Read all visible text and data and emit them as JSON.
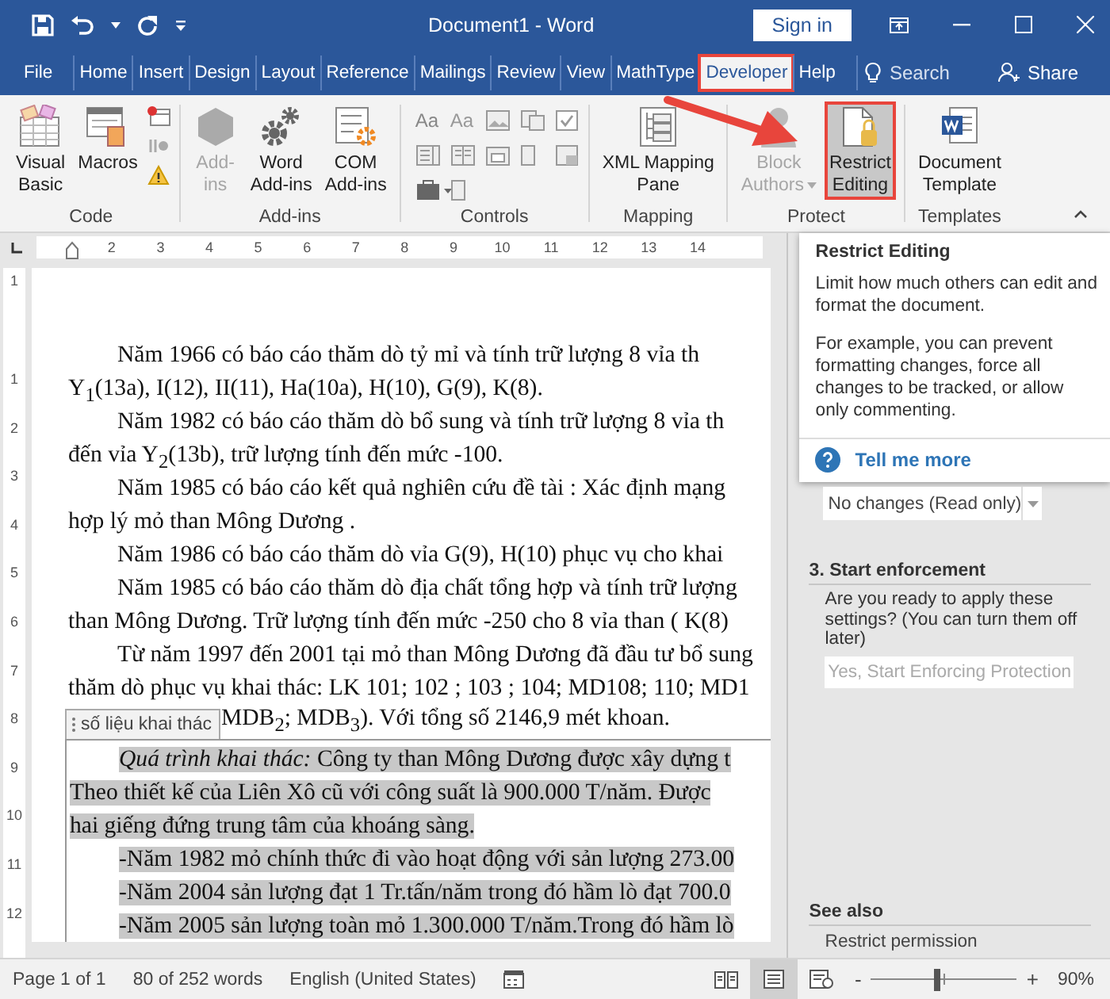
{
  "window": {
    "title": "Document1  -  Word",
    "sign_in": "Sign in"
  },
  "tabs": [
    {
      "label": "File",
      "selected": false,
      "highlighted": false
    },
    {
      "label": "Home",
      "selected": false,
      "highlighted": false
    },
    {
      "label": "Insert",
      "selected": false,
      "highlighted": false
    },
    {
      "label": "Design",
      "selected": false,
      "highlighted": false
    },
    {
      "label": "Layout",
      "selected": false,
      "highlighted": false
    },
    {
      "label": "Reference",
      "selected": false,
      "highlighted": false
    },
    {
      "label": "Mailings",
      "selected": false,
      "highlighted": false
    },
    {
      "label": "Review",
      "selected": false,
      "highlighted": false
    },
    {
      "label": "View",
      "selected": false,
      "highlighted": false
    },
    {
      "label": "MathType",
      "selected": false,
      "highlighted": false
    },
    {
      "label": "Developer",
      "selected": true,
      "highlighted": true
    },
    {
      "label": "Help",
      "selected": false,
      "highlighted": false
    }
  ],
  "search": {
    "placeholder": "Search"
  },
  "share": "Share",
  "ribbon": {
    "code": {
      "label": "Code",
      "visual_basic": "Visual\nBasic",
      "macros": "Macros"
    },
    "addins": {
      "label": "Add-ins",
      "buttons": [
        {
          "label": "Add-\nins",
          "disabled": true
        },
        {
          "label": "Word\nAdd-ins",
          "disabled": false
        },
        {
          "label": "COM\nAdd-ins",
          "disabled": false
        }
      ]
    },
    "controls": {
      "label": "Controls",
      "rich_text_glyph": "Aa",
      "plain_text_glyph": "Aa"
    },
    "mapping": {
      "label": "Mapping",
      "button": "XML Mapping\nPane"
    },
    "protect": {
      "label": "Protect",
      "buttons": [
        {
          "label": "Block\nAuthors",
          "disabled": true,
          "pressed": false,
          "highlighted": false
        },
        {
          "label": "Restrict\nEditing",
          "disabled": false,
          "pressed": true,
          "highlighted": true
        }
      ]
    },
    "templates": {
      "label": "Templates",
      "button": "Document\nTemplate"
    }
  },
  "ruler": {
    "horizontal": [
      "2",
      "3",
      "4",
      "5",
      "6",
      "7",
      "8",
      "9",
      "10",
      "11",
      "12",
      "13",
      "14"
    ],
    "vertical": [
      "1",
      "1",
      "2",
      "3",
      "4",
      "5",
      "6",
      "7",
      "8",
      "9",
      "10",
      "11",
      "12"
    ]
  },
  "document": {
    "lines": [
      {
        "text": "Năm 1966 có báo cáo thăm dò tỷ mỉ và tính trữ lượng 8 vỉa th",
        "indent": true
      },
      {
        "text": "Y$_{1}$(13a), I(12), II(11), Ha(10a), H(10), G(9), K(8).",
        "indent": false
      },
      {
        "text": "Năm 1982 có báo cáo thăm dò bổ sung và tính trữ lượng 8 vỉa th",
        "indent": true
      },
      {
        "text": "đến vỉa Y$_{2}$(13b), trữ lượng tính đến mức -100.",
        "indent": false
      },
      {
        "text": "Năm 1985 có báo cáo kết quả nghiên cứu đề tài : Xác định mạng",
        "indent": true
      },
      {
        "text": "hợp lý mỏ than Mông Dương .",
        "indent": false
      },
      {
        "text": "Năm 1986 có báo cáo thăm dò vỉa G(9), H(10) phục vụ cho khai",
        "indent": true
      },
      {
        "text": "Năm 1985 có báo cáo thăm dò địa chất tổng hợp và tính trữ  lượng",
        "indent": true
      },
      {
        "text": "than Mông Dương. Trữ lượng tính đến mức -250 cho 8 vỉa than ( K(8)",
        "indent": false
      },
      {
        "text": "Từ năm 1997 đến 2001 tại mỏ than Mông Dương đã đầu tư bổ sung",
        "indent": true
      },
      {
        "text": "thăm dò phục vụ khai thác: LK 101; 102 ; 103 ; 104; MD108; 110; MD1",
        "indent": false
      }
    ],
    "content_control": {
      "tag": "số liệu khai thác",
      "tag_line": "MDB$_{2}$; MDB$_{3}$). Với tổng số 2146,9 mét khoan.",
      "selected": true,
      "lines": [
        {
          "text": "*Quá trình khai thác:*  Công ty than Mông Dương được xây dựng t",
          "indent": true
        },
        {
          "text": "Theo thiết kế của Liên Xô cũ với công suất là 900.000 T/năm. Được",
          "indent": false
        },
        {
          "text": "hai giếng đứng trung tâm của khoáng sàng.",
          "indent": false
        },
        {
          "text": "-Năm 1982 mỏ chính thức đi vào hoạt động với sản lượng 273.00",
          "indent": true
        },
        {
          "text": "-Năm 2004 sản lượng đạt 1 Tr.tấn/năm trong đó hầm lò đạt  700.0",
          "indent": true
        },
        {
          "text": "-Năm 2005 sản lượng toàn mỏ 1.300.000 T/năm.Trong đó hầm lò",
          "indent": true
        }
      ]
    }
  },
  "pane": {
    "tooltip": {
      "title": "Restrict Editing",
      "paragraphs": [
        "Limit how much others can edit and format the document.",
        "For example, you can prevent formatting changes, force all changes to be tracked, or allow only commenting."
      ],
      "link": "Tell me more"
    },
    "dropdown": {
      "value": "No changes (Read only)"
    },
    "enforcement": {
      "heading": "3. Start enforcement",
      "text": "Are you ready to apply these settings? (You can turn them off later)",
      "button": {
        "label": "Yes, Start Enforcing Protection",
        "disabled": true
      }
    },
    "see_also": {
      "heading": "See also",
      "link": "Restrict permission"
    }
  },
  "status_bar": {
    "page": "Page 1 of 1",
    "words": "80 of 252 words",
    "language": "English (United States)",
    "views": [
      {
        "selected": false
      },
      {
        "selected": true
      },
      {
        "selected": false
      }
    ],
    "zoom": {
      "minus": "-",
      "plus": "+",
      "level": 0.45,
      "value": "90%"
    }
  }
}
